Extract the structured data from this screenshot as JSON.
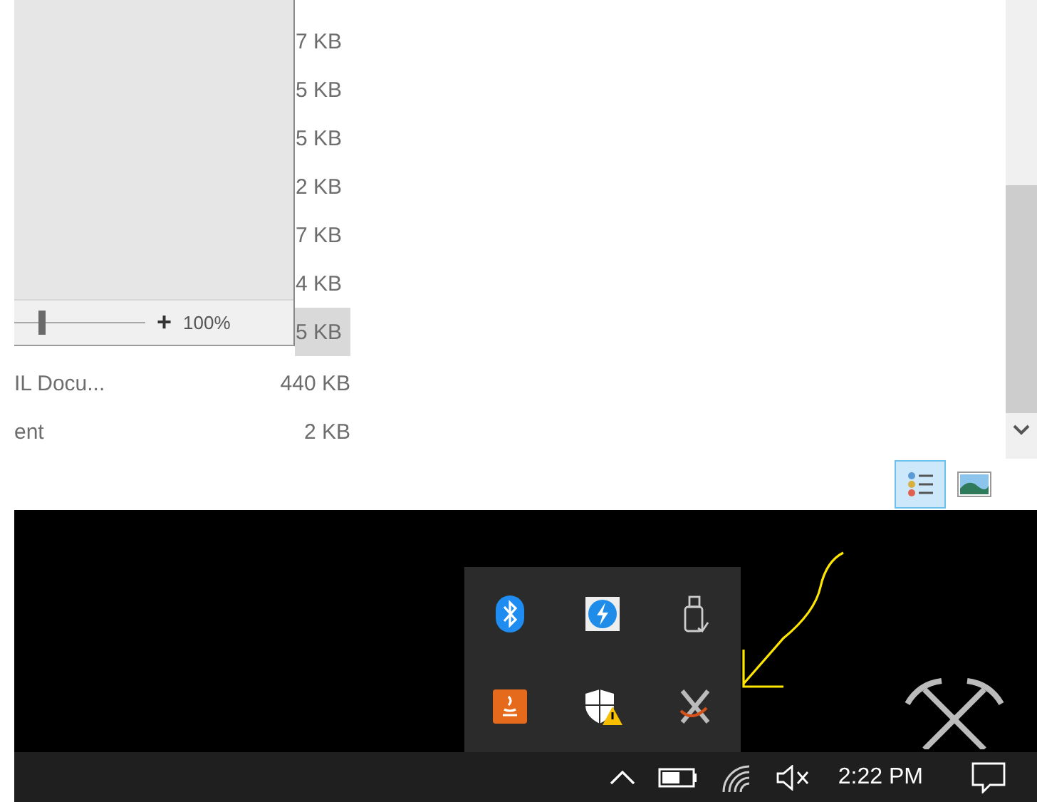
{
  "file_list": {
    "rows": [
      {
        "size": "7 KB",
        "selected": false
      },
      {
        "size": "5 KB",
        "selected": false
      },
      {
        "size": "5 KB",
        "selected": false
      },
      {
        "size": "2 KB",
        "selected": false
      },
      {
        "size": "7 KB",
        "selected": false
      },
      {
        "size": "4 KB",
        "selected": false
      },
      {
        "size": "5 KB",
        "selected": true
      },
      {
        "type": "IL Docu...",
        "size": "440 KB",
        "selected": false
      },
      {
        "type": "ent",
        "size": "2 KB",
        "selected": false
      }
    ]
  },
  "preview_pane": {
    "zoom": {
      "plus": "+",
      "level": 0.18,
      "reading": "100%"
    }
  },
  "view_buttons": [
    {
      "kind": "details",
      "selected": true
    },
    {
      "kind": "large-icons",
      "selected": false
    }
  ],
  "tray_overflow": {
    "icons": [
      {
        "kind": "bluetooth"
      },
      {
        "kind": "thunderbolt"
      },
      {
        "kind": "usb"
      },
      {
        "kind": "java"
      },
      {
        "kind": "security-warning"
      },
      {
        "kind": "crossed-tools"
      }
    ]
  },
  "taskbar": {
    "clock": "2:22 PM"
  }
}
